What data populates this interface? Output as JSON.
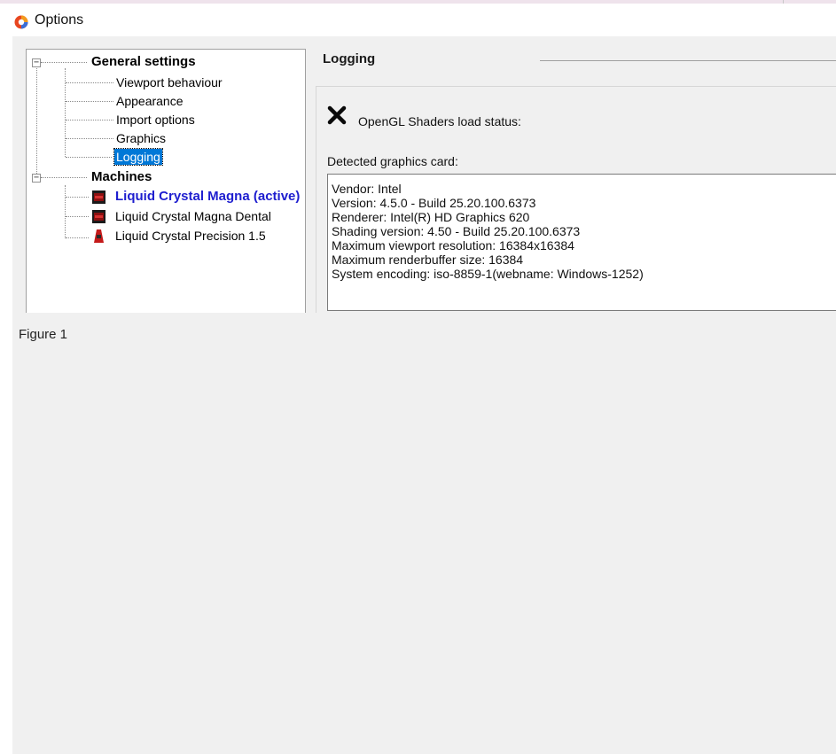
{
  "window": {
    "title": "Options",
    "icon": "app-logo-icon"
  },
  "tree": {
    "general": {
      "label": "General settings",
      "children": [
        "Viewport behaviour",
        "Appearance",
        "Import options",
        "Graphics",
        "Logging"
      ],
      "selected": "Logging"
    },
    "machines": {
      "label": "Machines",
      "children": [
        "Liquid Crystal Magna (active)",
        "Liquid Crystal Magna Dental",
        "Liquid Crystal Precision 1.5"
      ]
    }
  },
  "panel": {
    "title": "Logging",
    "shader_status_icon": "x-mark-icon",
    "shader_status_label": "OpenGL Shaders load status:",
    "card_label": "Detected graphics card:",
    "card_info": [
      "Vendor: Intel",
      "Version: 4.5.0 - Build 25.20.100.6373",
      "Renderer: Intel(R) HD Graphics 620",
      "Shading version: 4.50 - Build 25.20.100.6373",
      "Maximum viewport resolution: 16384x16384",
      "Maximum renderbuffer size: 16384",
      "System encoding: iso-8859-1(webname: Windows-1252)"
    ]
  },
  "caption": "Figure 1",
  "colors": {
    "selection": "#0078d7",
    "active_machine": "#1e1ecf",
    "background": "#f0f0f0"
  }
}
